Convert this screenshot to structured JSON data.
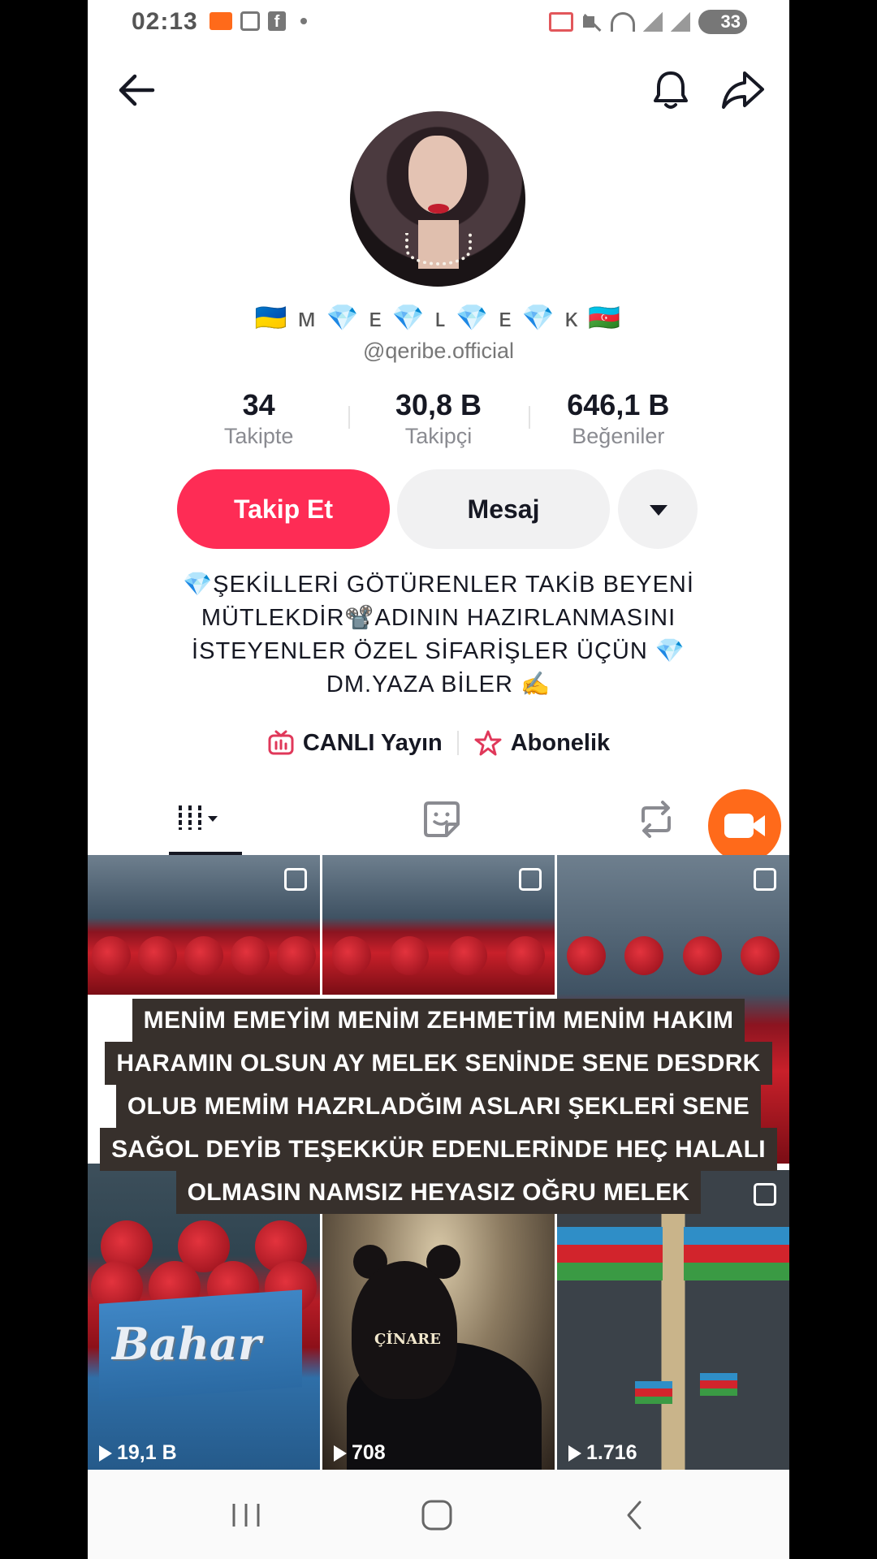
{
  "status_bar": {
    "time": "02:13",
    "battery": "33"
  },
  "profile": {
    "display_name": "🇺🇦 ᴍ 💎 ᴇ 💎 ʟ 💎 ᴇ 💎 ᴋ 🇦🇿",
    "username": "@qeribe.official",
    "stats": [
      {
        "value": "34",
        "label": "Takipte"
      },
      {
        "value": "30,8 B",
        "label": "Takipçi"
      },
      {
        "value": "646,1 B",
        "label": "Beğeniler"
      }
    ],
    "follow_label": "Takip Et",
    "message_label": "Mesaj",
    "bio_lines": [
      "💎ŞEKİLLERİ GÖTÜRENLER TAKİB BEYENİ",
      "MÜTLEKDİR📽️ADININ HAZIRLANMASINI",
      "İSTEYENLER ÖZEL SİFARİŞLER ÜÇÜN 💎",
      "DM.YAZA BİLER ✍️"
    ],
    "live_label": "CANLI Yayın",
    "subscription_label": "Abonelik"
  },
  "grid": {
    "items": [
      {
        "views": ""
      },
      {
        "views": ""
      },
      {
        "views": ""
      },
      {
        "views": "19,1 B",
        "text": "Bahar"
      },
      {
        "views": "708",
        "text": "ÇİNARE"
      },
      {
        "views": "1.716"
      }
    ]
  },
  "caption_lines": [
    "MENİM EMEYİM MENİM ZEHMETİM MENİM HAKIM",
    "HARAMIN OLSUN AY MELEK SENİNDE SENE DESDRK",
    "OLUB MEMİM HAZRLADĞIM ASLARI ŞEKLERİ SENE",
    "SAĞOL DEYİB TEŞEKKÜR EDENLERİNDE HEÇ HALALI",
    "OLMASIN  NAMSIZ HEYASIZ OĞRU MELEK"
  ],
  "colors": {
    "accent": "#fe2c55",
    "live_fab": "#ff6a1a"
  }
}
